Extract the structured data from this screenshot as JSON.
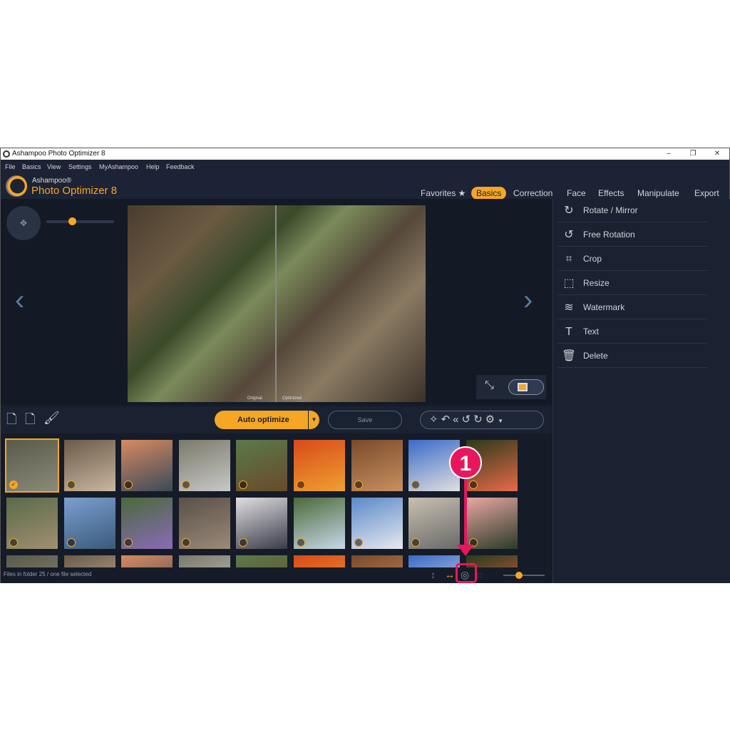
{
  "window": {
    "title": "Ashampoo Photo Optimizer 8",
    "minimize": "–",
    "restore": "❐",
    "close": "✕"
  },
  "menu": [
    "File",
    "Basics",
    "View",
    "Settings",
    "MyAshampoo",
    "Help",
    "Feedback"
  ],
  "brand": {
    "line1": "Ashampoo®",
    "line2": "Photo Optimizer 8"
  },
  "tabs": [
    {
      "label": "Favorites ★"
    },
    {
      "label": "Basics",
      "active": true
    },
    {
      "label": "Correction"
    },
    {
      "label": "Face"
    },
    {
      "label": "Effects"
    },
    {
      "label": "Manipulate"
    },
    {
      "label": "Export"
    }
  ],
  "viewer": {
    "original_label": "Original",
    "optimized_label": "Optimized",
    "zoom_level": 0.35,
    "prev": "‹",
    "next": "›"
  },
  "panel": [
    {
      "label": "Rotate / Mirror",
      "icon": "rotate-icon"
    },
    {
      "label": "Free Rotation",
      "icon": "free-rotation-icon"
    },
    {
      "label": "Crop",
      "icon": "crop-icon"
    },
    {
      "label": "Resize",
      "icon": "resize-icon"
    },
    {
      "label": "Watermark",
      "icon": "watermark-icon"
    },
    {
      "label": "Text",
      "icon": "text-icon"
    },
    {
      "label": "Delete",
      "icon": "trash-icon"
    }
  ],
  "toolbar": {
    "auto_optimize": "Auto optimize",
    "save": "Save"
  },
  "thumbnails": {
    "count_visible": 27,
    "selected_index": 0
  },
  "status": {
    "text": "Files in folder 25 / one file selected",
    "thumb_size": 0.35
  },
  "annotation": {
    "badge": "1",
    "color": "#e8175d"
  },
  "colors": {
    "accent": "#f5a623",
    "background": "#151b27"
  }
}
